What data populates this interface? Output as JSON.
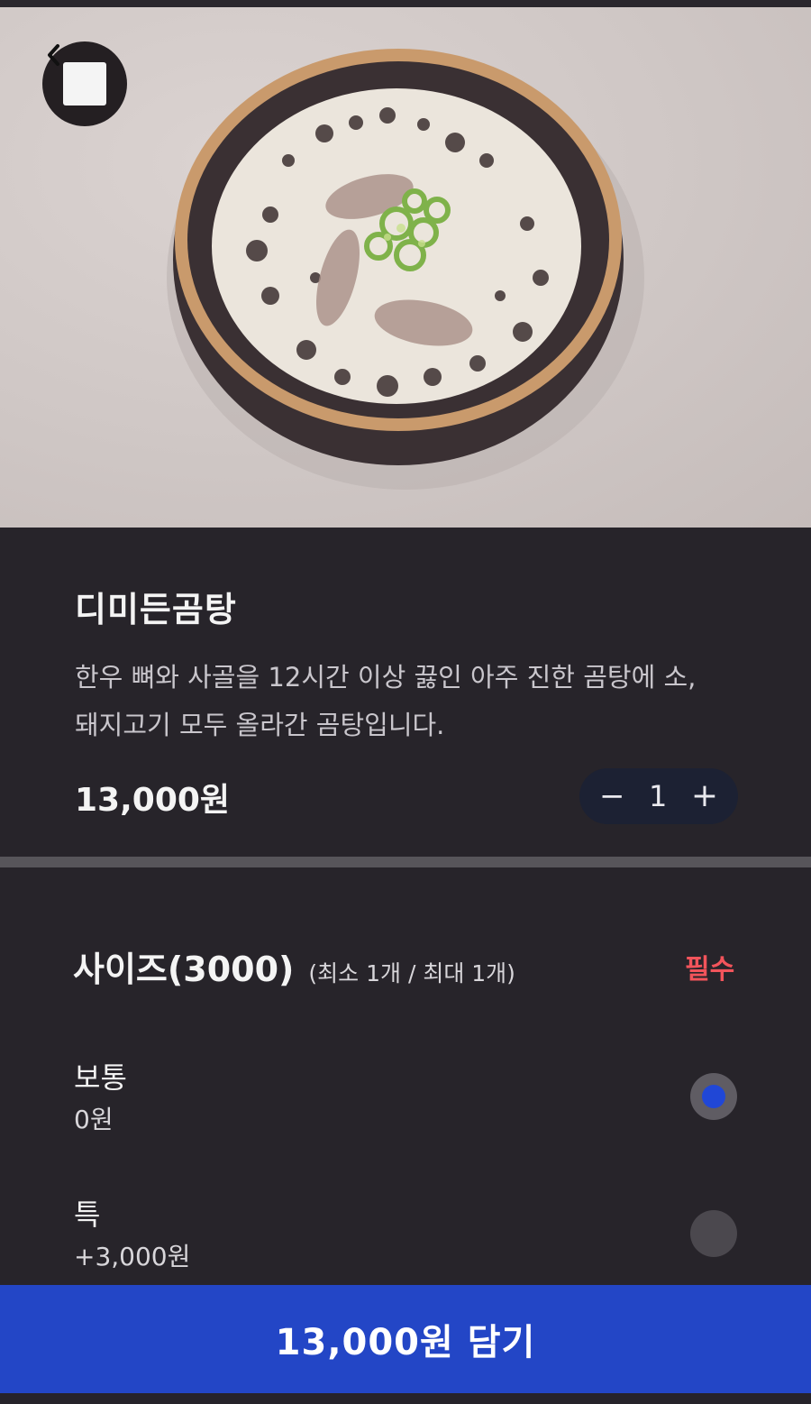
{
  "header": {
    "back_icon": "chevron-left-icon"
  },
  "product": {
    "image_alt": "bowl of beef bone soup",
    "title": "디미든곰탕",
    "description_line1": "한우 뼈와 사골을 12시간 이상 끓인 아주 진한 곰탕에 소,",
    "description_line2": "돼지고기 모두 올라간 곰탕입니다.",
    "price": "13,000원",
    "quantity": {
      "minus_label": "−",
      "value": "1",
      "plus_label": "+"
    }
  },
  "option_group": {
    "title": "사이즈(3000)",
    "limit": "(최소 1개 / 최대 1개)",
    "required_label": "필수",
    "choices": [
      {
        "name": "보통",
        "price": "0원",
        "selected": true
      },
      {
        "name": "특",
        "price": "+3,000원",
        "selected": false
      }
    ]
  },
  "footer": {
    "cart_button_label": "13,000원 담기"
  },
  "colors": {
    "background": "#27242a",
    "accent_blue": "#2346c6",
    "required_red": "#f2545b",
    "stepper_bg": "#1c2133"
  }
}
